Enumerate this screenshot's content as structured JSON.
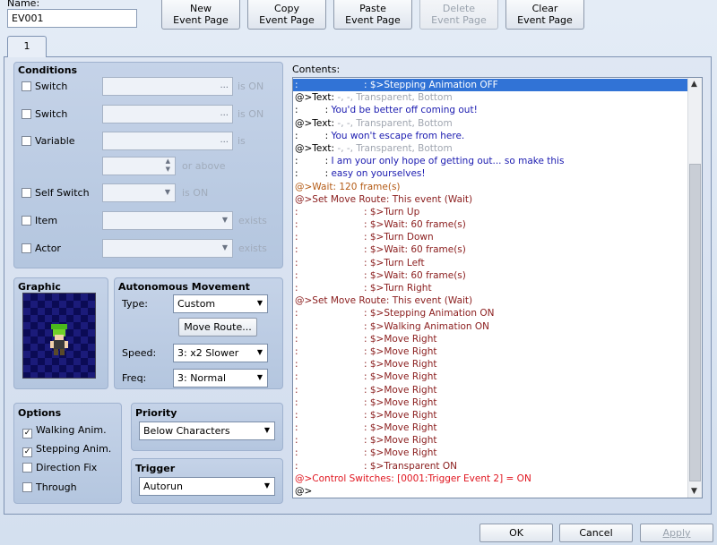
{
  "name_label": "Name:",
  "name_value": "EV001",
  "toolbar": [
    {
      "label": "New\nEvent Page",
      "enabled": true
    },
    {
      "label": "Copy\nEvent Page",
      "enabled": true
    },
    {
      "label": "Paste\nEvent Page",
      "enabled": true
    },
    {
      "label": "Delete\nEvent Page",
      "enabled": false
    },
    {
      "label": "Clear\nEvent Page",
      "enabled": true
    }
  ],
  "tab_label": "1",
  "conditions": {
    "title": "Conditions",
    "switch1": "Switch",
    "switch2": "Switch",
    "variable": "Variable",
    "self_switch": "Self Switch",
    "item": "Item",
    "actor": "Actor",
    "is_on": "is ON",
    "is": "is",
    "or_above": "or above",
    "exists": "exists",
    "dots": "..."
  },
  "graphic": {
    "title": "Graphic"
  },
  "autonomous": {
    "title": "Autonomous Movement",
    "type_label": "Type:",
    "type_value": "Custom",
    "move_route": "Move Route...",
    "speed_label": "Speed:",
    "speed_value": "3: x2 Slower",
    "freq_label": "Freq:",
    "freq_value": "3: Normal"
  },
  "options": {
    "title": "Options",
    "walking": "Walking Anim.",
    "stepping": "Stepping Anim.",
    "direction_fix": "Direction Fix",
    "through": "Through"
  },
  "priority": {
    "title": "Priority",
    "value": "Below Characters"
  },
  "trigger": {
    "title": "Trigger",
    "value": "Autorun"
  },
  "contents_label": "Contents:",
  "contents": [
    {
      "t": ":                      : $>Stepping Animation OFF",
      "c": "sel1"
    },
    {
      "t": "@>Text: -, -, Transparent, Bottom",
      "c": "text"
    },
    {
      "t": ":         : You'd be better off coming out!",
      "c": "navy"
    },
    {
      "t": "@>Text: -, -, Transparent, Bottom",
      "c": "text"
    },
    {
      "t": ":         : You won't escape from here.",
      "c": "navy"
    },
    {
      "t": "@>Text: -, -, Transparent, Bottom",
      "c": "text"
    },
    {
      "t": ":         : I am your only hope of getting out... so make this",
      "c": "navy"
    },
    {
      "t": ":         : easy on yourselves!",
      "c": "navy"
    },
    {
      "t": "@>Wait: 120 frame(s)",
      "c": "brn"
    },
    {
      "t": "@>Set Move Route: This event (Wait)",
      "c": "mar"
    },
    {
      "t": ":                      : $>Turn Up",
      "c": "mar"
    },
    {
      "t": ":                      : $>Wait: 60 frame(s)",
      "c": "mar"
    },
    {
      "t": ":                      : $>Turn Down",
      "c": "mar"
    },
    {
      "t": ":                      : $>Wait: 60 frame(s)",
      "c": "mar"
    },
    {
      "t": ":                      : $>Turn Left",
      "c": "mar"
    },
    {
      "t": ":                      : $>Wait: 60 frame(s)",
      "c": "mar"
    },
    {
      "t": ":                      : $>Turn Right",
      "c": "mar"
    },
    {
      "t": "@>Set Move Route: This event (Wait)",
      "c": "mar"
    },
    {
      "t": ":                      : $>Stepping Animation ON",
      "c": "mar"
    },
    {
      "t": ":                      : $>Walking Animation ON",
      "c": "mar"
    },
    {
      "t": ":                      : $>Move Right",
      "c": "mar"
    },
    {
      "t": ":                      : $>Move Right",
      "c": "mar"
    },
    {
      "t": ":                      : $>Move Right",
      "c": "mar"
    },
    {
      "t": ":                      : $>Move Right",
      "c": "mar"
    },
    {
      "t": ":                      : $>Move Right",
      "c": "mar"
    },
    {
      "t": ":                      : $>Move Right",
      "c": "mar"
    },
    {
      "t": ":                      : $>Move Right",
      "c": "mar"
    },
    {
      "t": ":                      : $>Move Right",
      "c": "mar"
    },
    {
      "t": ":                      : $>Move Right",
      "c": "mar"
    },
    {
      "t": ":                      : $>Move Right",
      "c": "mar"
    },
    {
      "t": ":                      : $>Transparent ON",
      "c": "mar"
    },
    {
      "t": "@>Control Switches: [0001:Trigger Event 2] = ON",
      "c": "red"
    },
    {
      "t": "@>",
      "c": "blk"
    }
  ],
  "buttons": {
    "ok": "OK",
    "cancel": "Cancel",
    "apply": "Apply"
  }
}
